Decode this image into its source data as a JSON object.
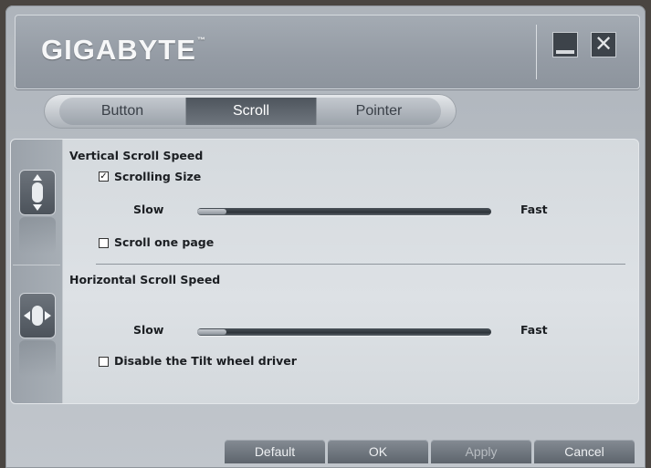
{
  "header": {
    "logo_text": "GIGABYTE",
    "trademark": "™",
    "minimize_icon": "minimize-icon",
    "close_icon": "close-icon",
    "close_glyph": "✕"
  },
  "tabs": [
    {
      "label": "Button",
      "active": false
    },
    {
      "label": "Scroll",
      "active": true
    },
    {
      "label": "Pointer",
      "active": false
    }
  ],
  "vertical": {
    "title": "Vertical Scroll Speed",
    "scrolling_size_label": "Scrolling Size",
    "scrolling_size_checked": true,
    "check_glyph": "✓",
    "slow_label": "Slow",
    "fast_label": "Fast",
    "speed_level": 0.1,
    "scroll_one_page_label": "Scroll one page",
    "scroll_one_page_checked": false,
    "icon": "vertical-scroll-icon"
  },
  "horizontal": {
    "title": "Horizontal Scroll Speed",
    "slow_label": "Slow",
    "fast_label": "Fast",
    "speed_level": 0.1,
    "disable_tilt_label": "Disable the Tilt wheel driver",
    "disable_tilt_checked": false,
    "icon": "horizontal-scroll-icon"
  },
  "footer": {
    "default_label": "Default",
    "ok_label": "OK",
    "apply_label": "Apply",
    "apply_enabled": false,
    "cancel_label": "Cancel"
  },
  "colors": {
    "active_tab": "#4e555d",
    "panel_bg": "#d9dee2",
    "button_bg": "#6c737b"
  }
}
